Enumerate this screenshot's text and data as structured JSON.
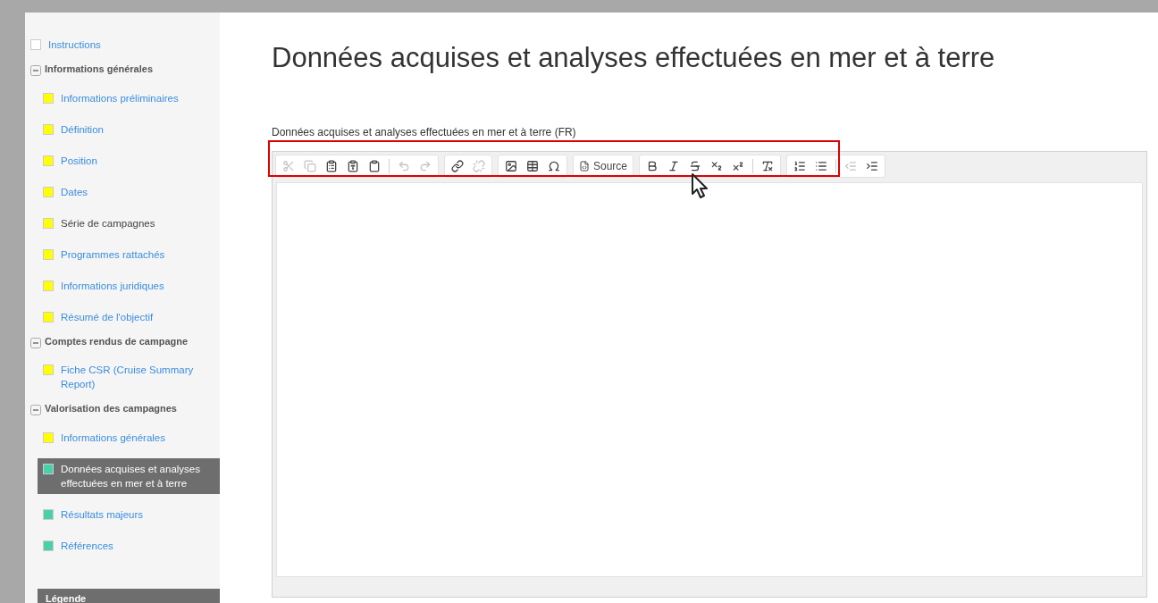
{
  "sidebar": {
    "items": [
      {
        "kind": "page",
        "label": "Instructions",
        "color": "#ffffff",
        "linked": true,
        "selected": false
      },
      {
        "kind": "group",
        "label": "Informations générales",
        "expanded": true,
        "children": [
          {
            "label": "Informations préliminaires",
            "color": "#ffff00",
            "linked": true,
            "selected": false
          },
          {
            "label": "Définition",
            "color": "#ffff00",
            "linked": true,
            "selected": false
          },
          {
            "label": "Position",
            "color": "#ffff00",
            "linked": true,
            "selected": false
          },
          {
            "label": "Dates",
            "color": "#ffff00",
            "linked": true,
            "selected": false
          },
          {
            "label": "Série de campagnes",
            "color": "#ffff00",
            "linked": false,
            "selected": false
          },
          {
            "label": "Programmes rattachés",
            "color": "#ffff00",
            "linked": true,
            "selected": false
          },
          {
            "label": "Informations juridiques",
            "color": "#ffff00",
            "linked": true,
            "selected": false
          },
          {
            "label": "Résumé de l'objectif",
            "color": "#ffff00",
            "linked": true,
            "selected": false
          }
        ]
      },
      {
        "kind": "group",
        "label": "Comptes rendus de campagne",
        "expanded": true,
        "children": [
          {
            "label": "Fiche CSR (Cruise Summary Report)",
            "color": "#ffff00",
            "linked": true,
            "selected": false
          }
        ]
      },
      {
        "kind": "group",
        "label": "Valorisation des campagnes",
        "expanded": true,
        "children": [
          {
            "label": "Informations générales",
            "color": "#ffff00",
            "linked": true,
            "selected": false
          },
          {
            "label": "Données acquises et analyses effectuées en mer et à terre",
            "color": "#48d1a8",
            "linked": true,
            "selected": true
          },
          {
            "label": "Résultats majeurs",
            "color": "#48d1a8",
            "linked": true,
            "selected": false
          },
          {
            "label": "Références",
            "color": "#48d1a8",
            "linked": true,
            "selected": false
          }
        ]
      }
    ],
    "legend_title": "Légende"
  },
  "page_title": "Données acquises et analyses effectuées en mer et à terre",
  "editor": {
    "label": "Données acquises et analyses effectuées en mer et à terre (FR)",
    "toolbar": [
      [
        {
          "kind": "cut",
          "disabled": true
        },
        {
          "kind": "copy",
          "disabled": true
        },
        {
          "kind": "paste",
          "disabled": false
        },
        {
          "kind": "paste-text",
          "disabled": false
        },
        {
          "kind": "paste-word",
          "disabled": false
        },
        {
          "kind": "sep"
        },
        {
          "kind": "undo",
          "disabled": true
        },
        {
          "kind": "redo",
          "disabled": true
        }
      ],
      [
        {
          "kind": "link",
          "disabled": false
        },
        {
          "kind": "unlink",
          "disabled": true
        }
      ],
      [
        {
          "kind": "image",
          "disabled": false
        },
        {
          "kind": "table",
          "disabled": false
        },
        {
          "kind": "special-char",
          "disabled": false
        }
      ],
      [
        {
          "kind": "source",
          "label": "Source",
          "disabled": false
        }
      ],
      [
        {
          "kind": "bold",
          "disabled": false
        },
        {
          "kind": "italic",
          "disabled": false
        },
        {
          "kind": "strike",
          "disabled": false
        },
        {
          "kind": "subscript",
          "disabled": false
        },
        {
          "kind": "superscript",
          "disabled": false
        },
        {
          "kind": "sep"
        },
        {
          "kind": "clear-format",
          "disabled": false
        }
      ],
      [
        {
          "kind": "numbered-list",
          "disabled": false
        },
        {
          "kind": "bulleted-list",
          "disabled": false
        },
        {
          "kind": "sep"
        },
        {
          "kind": "outdent",
          "disabled": true
        },
        {
          "kind": "indent",
          "disabled": false
        }
      ]
    ]
  }
}
